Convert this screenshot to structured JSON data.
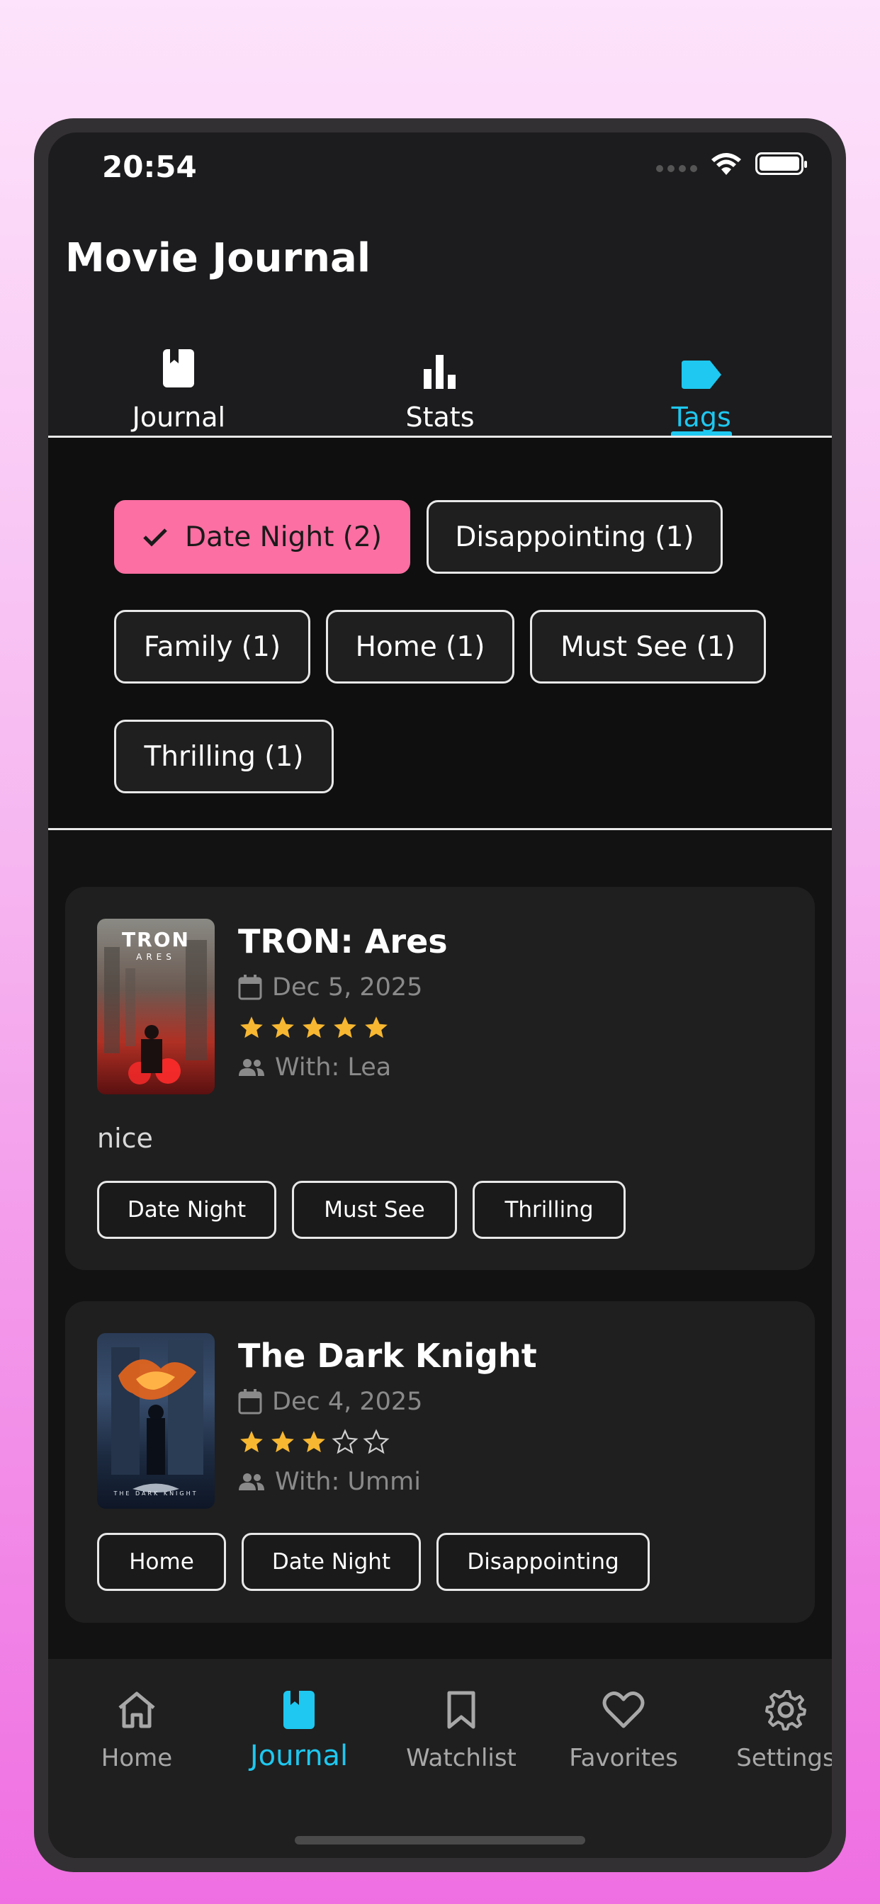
{
  "status_bar": {
    "time": "20:54"
  },
  "app": {
    "title": "Movie Journal"
  },
  "tabs": [
    {
      "label": "Journal",
      "icon": "book-icon",
      "active": false
    },
    {
      "label": "Stats",
      "icon": "bar-chart-icon",
      "active": false
    },
    {
      "label": "Tags",
      "icon": "tag-icon",
      "active": true
    }
  ],
  "tag_filters": [
    {
      "label": "Date Night (2)",
      "selected": true
    },
    {
      "label": "Disappointing (1)",
      "selected": false
    },
    {
      "label": "Family (1)",
      "selected": false
    },
    {
      "label": "Home (1)",
      "selected": false
    },
    {
      "label": "Must See (1)",
      "selected": false
    },
    {
      "label": "Thrilling (1)",
      "selected": false
    }
  ],
  "entries": [
    {
      "title": "TRON: Ares",
      "poster_text": "TRON",
      "poster_subtext": "ARES",
      "date": "Dec 5, 2025",
      "rating": 5,
      "with": "With: Lea",
      "note": "nice",
      "tags": [
        "Date Night",
        "Must See",
        "Thrilling"
      ]
    },
    {
      "title": "The Dark Knight",
      "poster_text": "THE DARK KNIGHT",
      "date": "Dec 4, 2025",
      "rating": 3,
      "with": "With: Ummi",
      "tags": [
        "Home",
        "Date Night",
        "Disappointing"
      ]
    }
  ],
  "bottom_nav": [
    {
      "label": "Home",
      "icon": "home-icon"
    },
    {
      "label": "Journal",
      "icon": "book-icon",
      "active": true
    },
    {
      "label": "Watchlist",
      "icon": "bookmark-icon"
    },
    {
      "label": "Favorites",
      "icon": "heart-icon"
    },
    {
      "label": "Settings",
      "icon": "gear-icon"
    }
  ],
  "colors": {
    "accent": "#1ec8f0",
    "selected_chip": "#fb6fa2",
    "star": "#f7b731",
    "background": "#1c1c1e"
  }
}
